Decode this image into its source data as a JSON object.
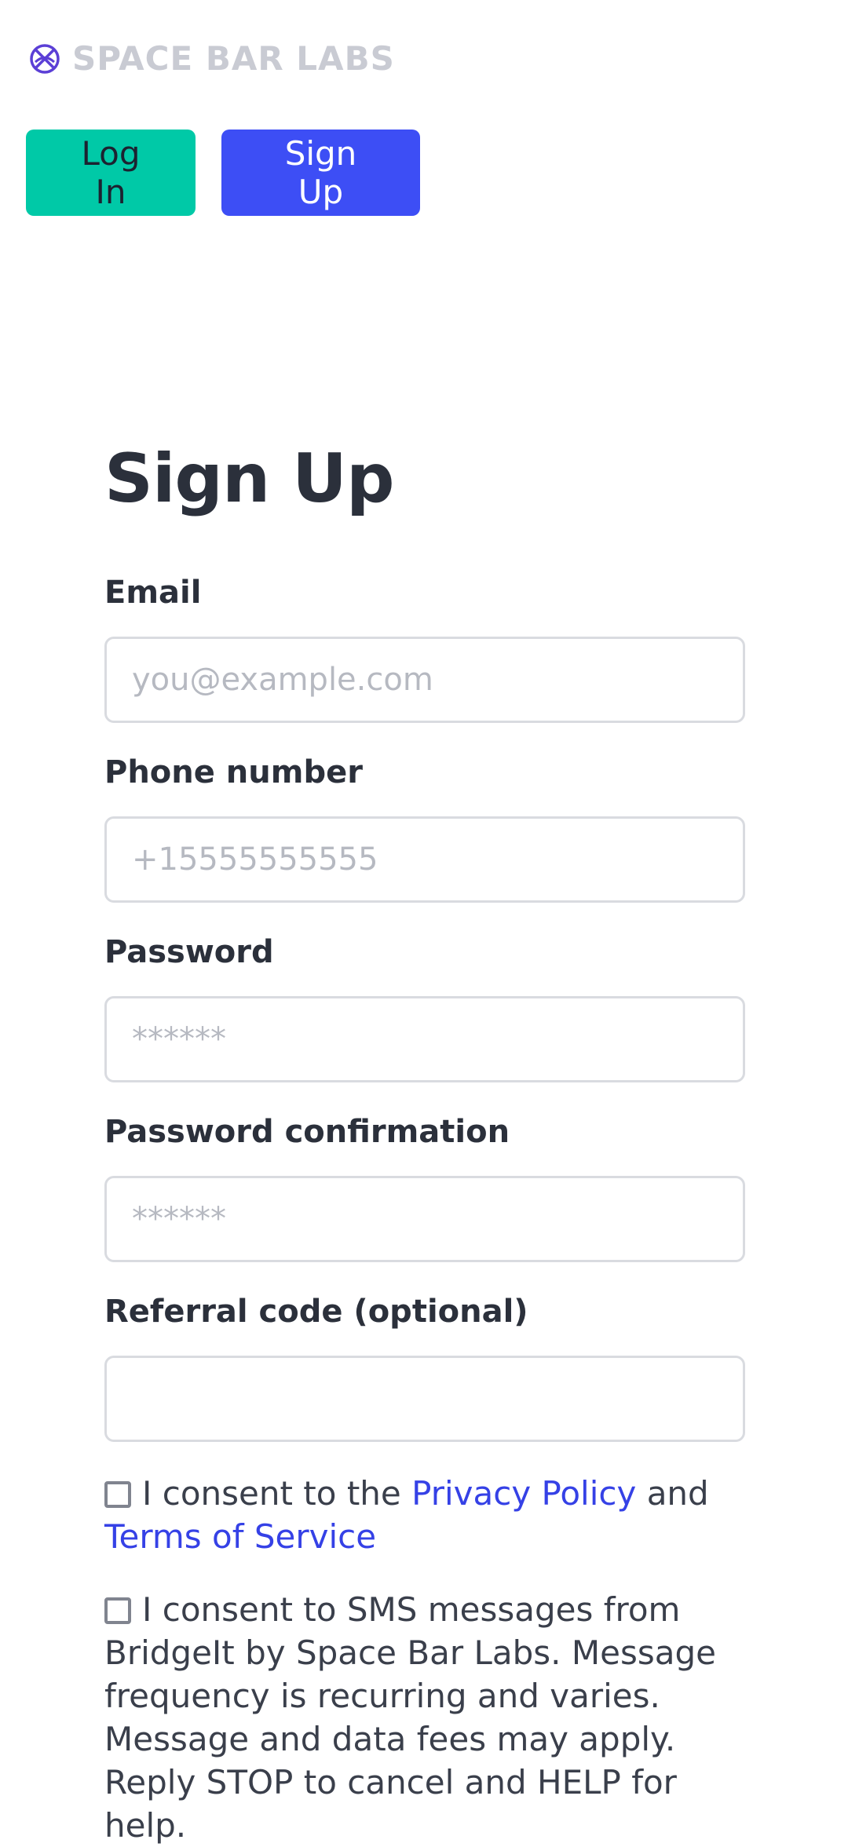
{
  "header": {
    "brand": "SPACE BAR LABS",
    "login_label": "Log In",
    "signup_label": "Sign Up"
  },
  "form": {
    "title": "Sign Up",
    "email_label": "Email",
    "email_placeholder": "you@example.com",
    "phone_label": "Phone number",
    "phone_placeholder": "+15555555555",
    "password_label": "Password",
    "password_placeholder": "******",
    "password_confirmation_label": "Password confirmation",
    "password_confirmation_placeholder": "******",
    "referral_label": "Referral code (optional)",
    "referral_value": ""
  },
  "consent_privacy": {
    "prefix": "I consent to the ",
    "privacy_link": "Privacy Policy",
    "middle": " and ",
    "terms_link": "Terms of Service",
    "checked": false
  },
  "consent_sms": {
    "text": "I consent to SMS messages from BridgeIt by Space Bar Labs. Message frequency is recurring and varies. Message and data fees may apply. Reply STOP to cancel and HELP for help.",
    "checked": false
  },
  "colors": {
    "login_button": "#00c9a7",
    "signup_button": "#3d4ef5",
    "link": "#3541e6",
    "logo_mark": "#5b3fd6"
  }
}
